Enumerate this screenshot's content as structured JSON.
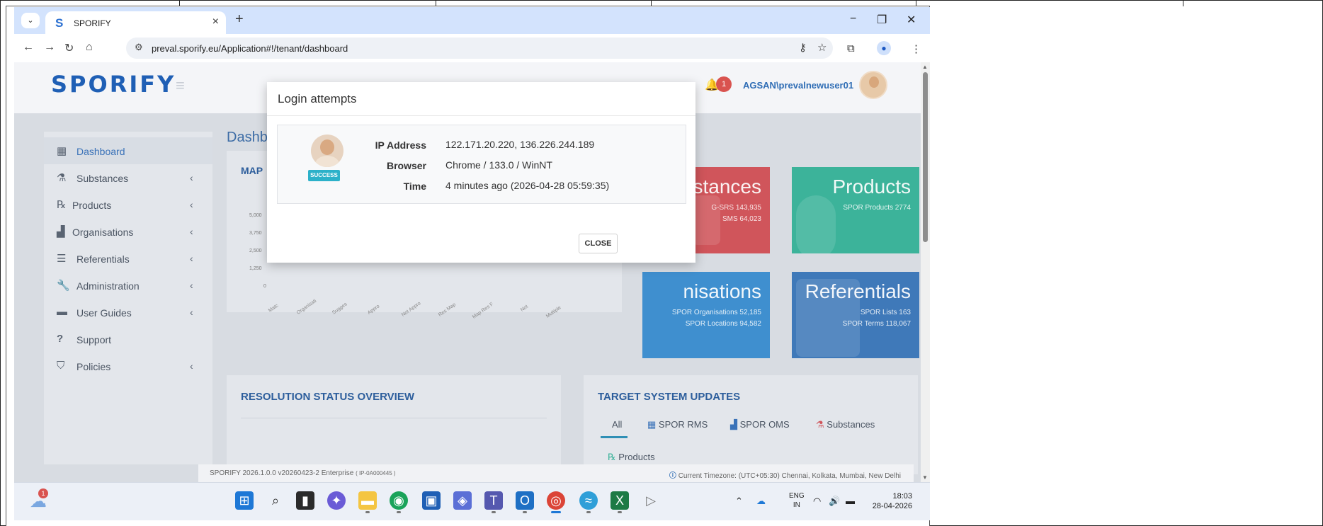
{
  "browser": {
    "tab_title": "SPORIFY",
    "tab_favicon": "S",
    "url": "preval.sporify.eu/Application#!/tenant/dashboard"
  },
  "header": {
    "logo": "SPORIFY",
    "notification_count": "1",
    "username": "AGSAN\\prevalnewuser01"
  },
  "sidebar": {
    "items": [
      {
        "label": "Dashboard",
        "icon": "▦"
      },
      {
        "label": "Substances",
        "icon": "⚗"
      },
      {
        "label": "Products",
        "icon": "℞"
      },
      {
        "label": "Organisations",
        "icon": "▟"
      },
      {
        "label": "Referentials",
        "icon": "☰"
      },
      {
        "label": "Administration",
        "icon": "🔧"
      },
      {
        "label": "User Guides",
        "icon": "▬"
      },
      {
        "label": "Support",
        "icon": "?"
      },
      {
        "label": "Policies",
        "icon": "⛉"
      }
    ],
    "chevron": "‹"
  },
  "dashboard": {
    "title": "Dashb",
    "map_card_title": "MAP",
    "map_y_ticks": [
      "5,000",
      "3,750",
      "2,500",
      "1,250",
      "0"
    ],
    "map_x_ticks": [
      "Matc",
      "Organisati",
      "Sugges",
      "Appro",
      "Not Appro",
      "Res Map",
      "Map Res F",
      "Not",
      "Multiple"
    ]
  },
  "tiles": {
    "substances": {
      "title": "stances",
      "line1": "G-SRS 143,935",
      "line2": "SMS 64,023",
      "color": "#d0555b"
    },
    "products": {
      "title": "Products",
      "line1": "SPOR Products 2774",
      "color": "#3cb39a"
    },
    "organisations": {
      "title": "nisations",
      "line1": "SPOR Organisations 52,185",
      "line2": "SPOR Locations 94,582",
      "color": "#3f8fcf"
    },
    "referentials": {
      "title": "Referentials",
      "line1": "SPOR Lists 163",
      "line2": "SPOR Terms 118,067",
      "color": "#3f79b9"
    }
  },
  "resolution_card": {
    "title": "RESOLUTION STATUS OVERVIEW"
  },
  "target_card": {
    "title": "TARGET SYSTEM UPDATES",
    "tabs": [
      "All",
      "SPOR RMS",
      "SPOR OMS",
      "Substances",
      "Products"
    ]
  },
  "footer": {
    "version": "SPORIFY 2026.1.0.0 v20260423-2 Enterprise",
    "version_tag": "( IP-0A000445 )",
    "timezone": "Current Timezone: (UTC+05:30) Chennai, Kolkata, Mumbai, New Delhi"
  },
  "modal": {
    "title": "Login attempts",
    "status": "SUCCESS",
    "ip_label": "IP Address",
    "ip_value": "122.171.20.220, 136.226.244.189",
    "browser_label": "Browser",
    "browser_value": "Chrome / 133.0 / WinNT",
    "time_label": "Time",
    "time_value": "4 minutes ago (2026-04-28 05:59:35)",
    "close_label": "CLOSE"
  },
  "taskbar": {
    "weather_badge": "1",
    "lang_top": "ENG",
    "lang_bottom": "IN",
    "time": "18:03",
    "date": "28-04-2026"
  }
}
